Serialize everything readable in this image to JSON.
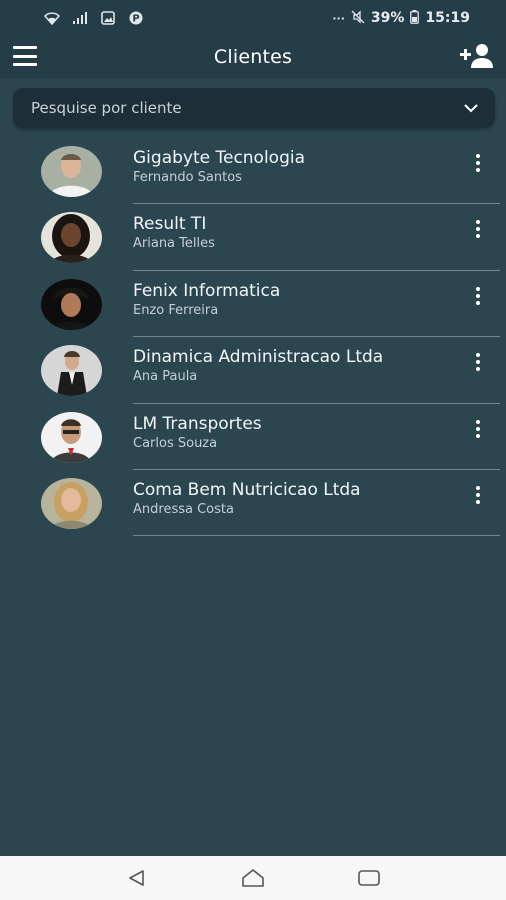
{
  "status_bar": {
    "left_icons": [
      "wifi-icon",
      "signal-icon",
      "gallery-icon",
      "p-icon"
    ],
    "dots": "···",
    "battery_percent": "39%",
    "time": "15:19"
  },
  "app_bar": {
    "title": "Clientes",
    "menu_icon": "hamburger-menu-icon",
    "action_icon": "add-user-icon"
  },
  "search": {
    "placeholder": "Pesquise por cliente"
  },
  "clients": [
    {
      "company": "Gigabyte Tecnologia",
      "contact": "Fernando Santos"
    },
    {
      "company": "Result TI",
      "contact": "Ariana Telles"
    },
    {
      "company": "Fenix Informatica",
      "contact": "Enzo Ferreira"
    },
    {
      "company": "Dinamica Administracao Ltda",
      "contact": "Ana Paula"
    },
    {
      "company": "LM Transportes",
      "contact": "Carlos Souza"
    },
    {
      "company": "Coma Bem Nutricicao Ltda",
      "contact": "Andressa Costa"
    }
  ],
  "colors": {
    "background": "#2c4650",
    "app_bar": "#253d46",
    "search_box": "#1c2f36",
    "divider": "#6e8790",
    "nav_bar": "#f7f7f7"
  }
}
